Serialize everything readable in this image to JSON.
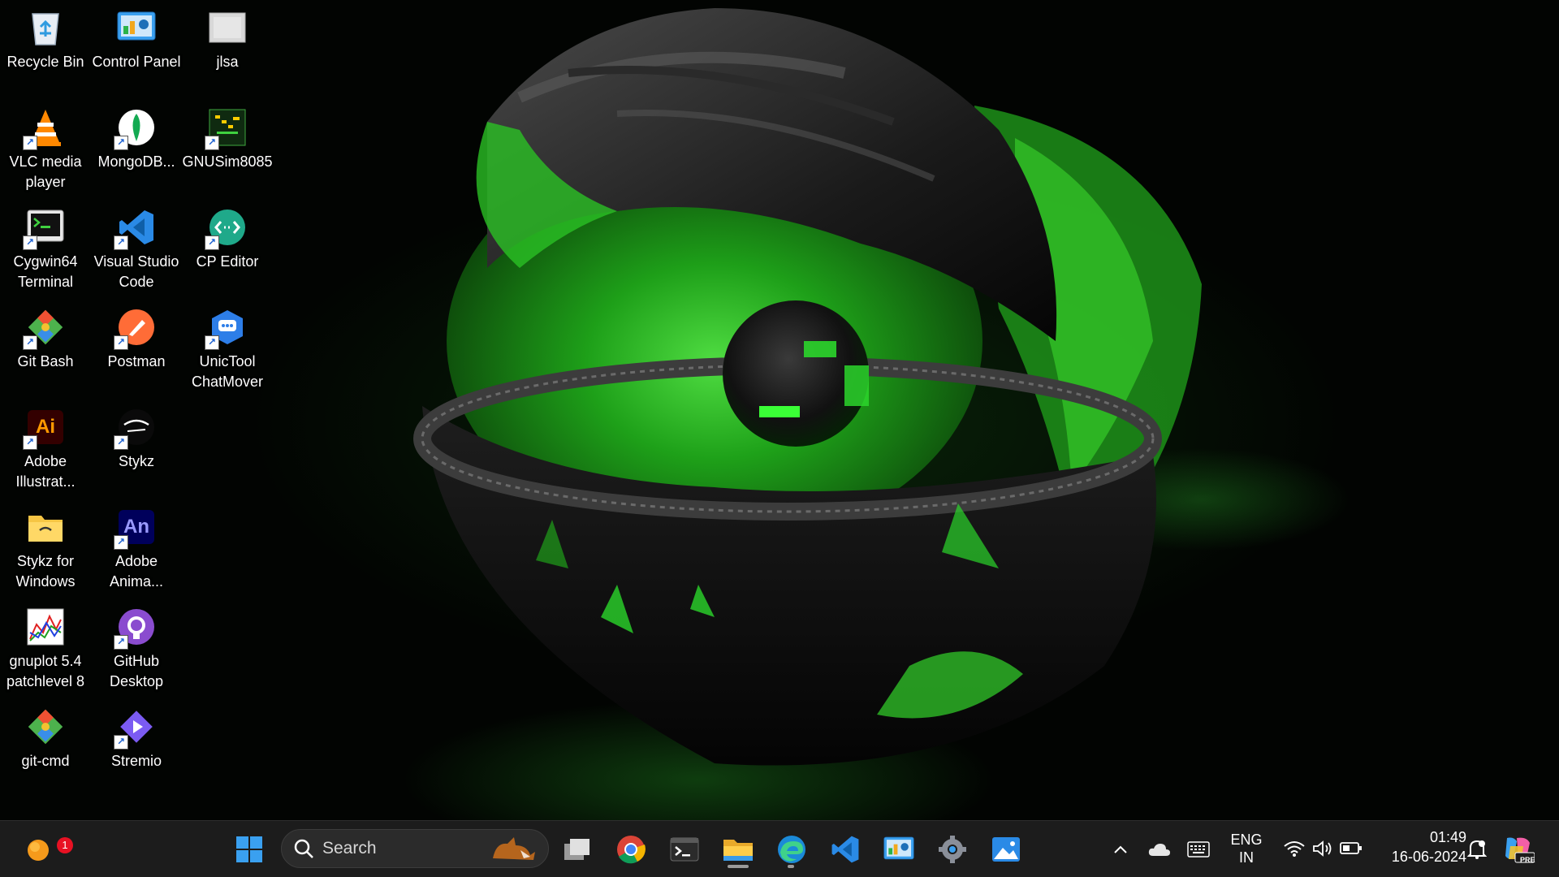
{
  "desktop": {
    "icons": [
      {
        "label": "Recycle Bin",
        "icon": "recycle-bin-icon"
      },
      {
        "label": "Control Panel",
        "icon": "control-panel-icon"
      },
      {
        "label": "jlsa",
        "icon": "file-icon"
      },
      {
        "label": "VLC media player",
        "icon": "vlc-icon"
      },
      {
        "label": "MongoDB...",
        "icon": "mongodb-icon"
      },
      {
        "label": "GNUSim8085",
        "icon": "gnusim8085-icon"
      },
      {
        "label": "Cygwin64 Terminal",
        "icon": "cygwin-terminal-icon"
      },
      {
        "label": "Visual Studio Code",
        "icon": "vscode-icon"
      },
      {
        "label": "CP Editor",
        "icon": "cp-editor-icon"
      },
      {
        "label": "Git Bash",
        "icon": "git-bash-icon"
      },
      {
        "label": "Postman",
        "icon": "postman-icon"
      },
      {
        "label": "UnicTool ChatMover",
        "icon": "chatmover-icon"
      },
      {
        "label": "Adobe Illustrat...",
        "icon": "adobe-illustrator-icon",
        "glyph": "Ai"
      },
      {
        "label": "Stykz",
        "icon": "stykz-icon"
      },
      {
        "label": "Stykz for Windows",
        "icon": "folder-icon"
      },
      {
        "label": "Adobe Anima...",
        "icon": "adobe-animate-icon",
        "glyph": "An"
      },
      {
        "label": "gnuplot 5.4 patchlevel 8",
        "icon": "gnuplot-icon"
      },
      {
        "label": "GitHub Desktop",
        "icon": "github-desktop-icon"
      },
      {
        "label": "git-cmd",
        "icon": "git-cmd-icon"
      },
      {
        "label": "Stremio",
        "icon": "stremio-icon"
      }
    ]
  },
  "taskbar": {
    "widgets_badge": "1",
    "search_label": "Search",
    "pinned": [
      {
        "name": "start-button",
        "icon": "windows-logo-icon"
      },
      {
        "name": "task-view-button",
        "icon": "task-view-icon"
      },
      {
        "name": "chrome-button",
        "icon": "chrome-icon"
      },
      {
        "name": "terminal-button",
        "icon": "terminal-icon"
      },
      {
        "name": "file-explorer-button",
        "icon": "folder-icon"
      },
      {
        "name": "edge-button",
        "icon": "edge-icon"
      },
      {
        "name": "vscode-button",
        "icon": "vscode-icon"
      },
      {
        "name": "control-panel-button",
        "icon": "control-panel-icon"
      },
      {
        "name": "settings-button",
        "icon": "gear-icon"
      },
      {
        "name": "photos-button",
        "icon": "photos-icon"
      }
    ],
    "tray": {
      "language_line1": "ENG",
      "language_line2": "IN",
      "time": "01:49",
      "date": "16-06-2024",
      "copilot_badge": "PRE"
    }
  },
  "colors": {
    "taskbar_bg": "#1c1c1c",
    "accent_green": "#2bd62b",
    "vscode_blue": "#2a8ae6",
    "windows_blue": "#3aa0f0"
  }
}
